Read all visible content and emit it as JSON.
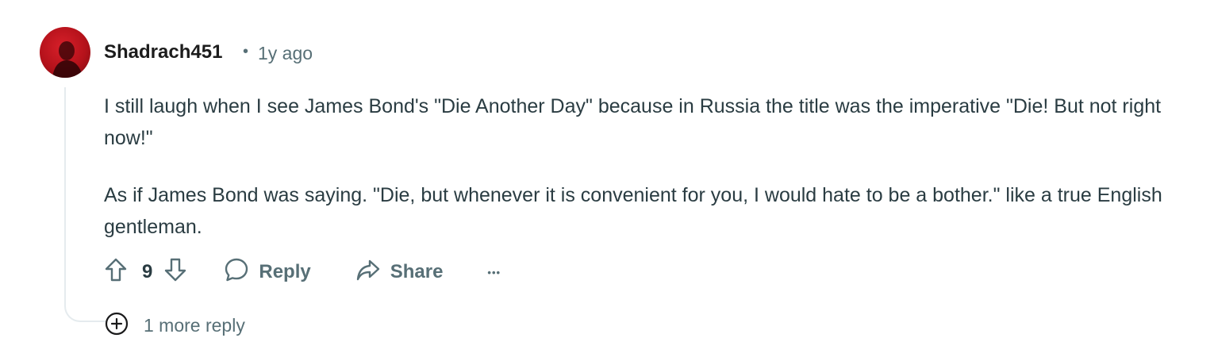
{
  "comment": {
    "author": "Shadrach451",
    "separator": "•",
    "age": "1y ago",
    "paragraphs": [
      "I still laugh when I see James Bond's \"Die Another Day\" because in Russia the title was the imperative \"Die! But not right now!\"",
      "As if James Bond was saying. \"Die, but whenever it is convenient for you, I would hate to be a bother.\" like a true English gentleman."
    ],
    "score": "9"
  },
  "actions": {
    "reply_label": "Reply",
    "share_label": "Share",
    "more_label": "•••"
  },
  "more_replies_label": "1 more reply",
  "colors": {
    "avatar_red": "#c4161f",
    "meta_gray": "#576f76",
    "thread_line": "#e5ebee"
  }
}
